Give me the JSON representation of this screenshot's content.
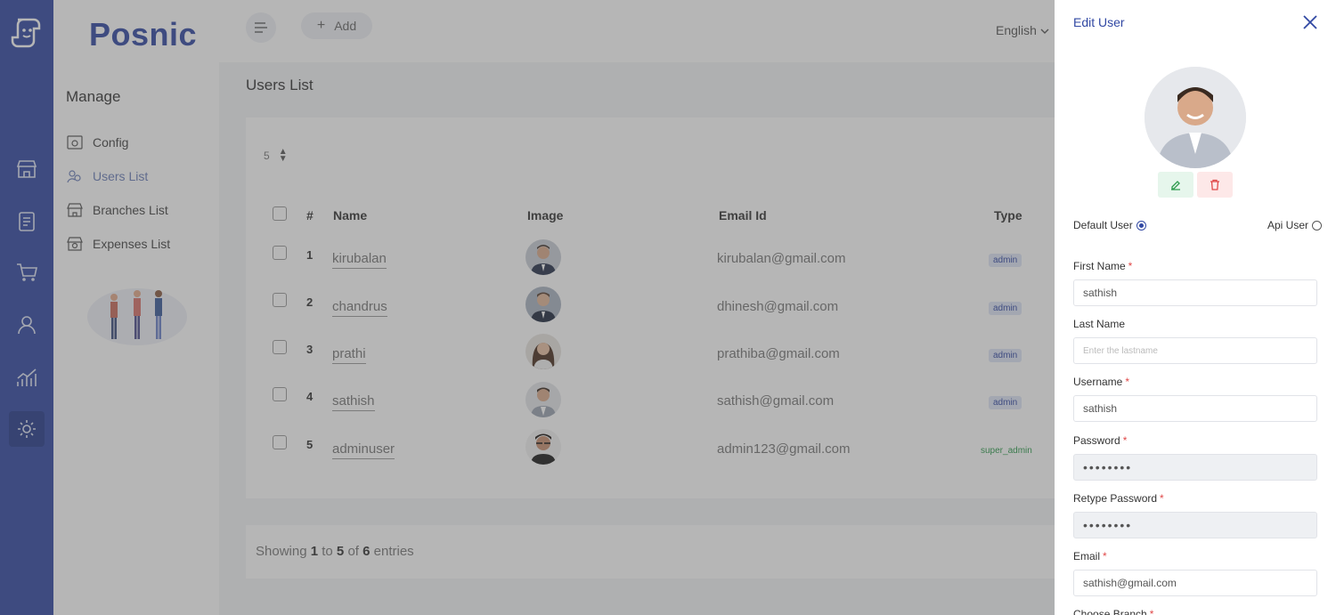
{
  "brand": "Posnic",
  "sidebar": {
    "heading": "Manage",
    "items": [
      {
        "label": "Config",
        "icon": "config-icon"
      },
      {
        "label": "Users List",
        "icon": "users-icon"
      },
      {
        "label": "Branches List",
        "icon": "branches-icon"
      },
      {
        "label": "Expenses List",
        "icon": "expenses-icon"
      }
    ]
  },
  "rail": [
    "store-icon",
    "clipboard-icon",
    "cart-icon",
    "user-icon",
    "chart-icon",
    "settings-icon"
  ],
  "topbar": {
    "add_label": "Add",
    "language": "English"
  },
  "page": {
    "title": "Users List"
  },
  "table": {
    "per_page": "5",
    "headers": {
      "num": "#",
      "name": "Name",
      "image": "Image",
      "email": "Email Id",
      "type": "Type"
    },
    "rows": [
      {
        "num": "1",
        "name": "kirubalan",
        "email": "kirubalan@gmail.com",
        "type": "admin"
      },
      {
        "num": "2",
        "name": "chandrus",
        "email": "dhinesh@gmail.com",
        "type": "admin"
      },
      {
        "num": "3",
        "name": "prathi",
        "email": "prathiba@gmail.com",
        "type": "admin"
      },
      {
        "num": "4",
        "name": "sathish",
        "email": "sathish@gmail.com",
        "type": "admin"
      },
      {
        "num": "5",
        "name": "adminuser",
        "email": "admin123@gmail.com",
        "type": "super_admin"
      }
    ],
    "footer": {
      "prefix": "Showing",
      "from": "1",
      "to_word": "to",
      "to": "5",
      "of_word": "of",
      "total": "6",
      "suffix": "entries"
    }
  },
  "drawer": {
    "title": "Edit User",
    "default_user": "Default User",
    "api_user": "Api User",
    "first_name_label": "First Name",
    "first_name_value": "sathish",
    "last_name_label": "Last Name",
    "last_name_placeholder": "Enter the lastname",
    "username_label": "Username",
    "username_value": "sathish",
    "password_label": "Password",
    "password_value": "••••••••",
    "retype_label": "Retype Password",
    "retype_value": "••••••••",
    "email_label": "Email",
    "email_value": "sathish@gmail.com",
    "branch_label": "Choose Branch"
  },
  "colors": {
    "brand": "#3148a3",
    "admin_badge": "#dfe5f7",
    "super_admin_text": "#2e9b4d",
    "required": "#e04848"
  }
}
